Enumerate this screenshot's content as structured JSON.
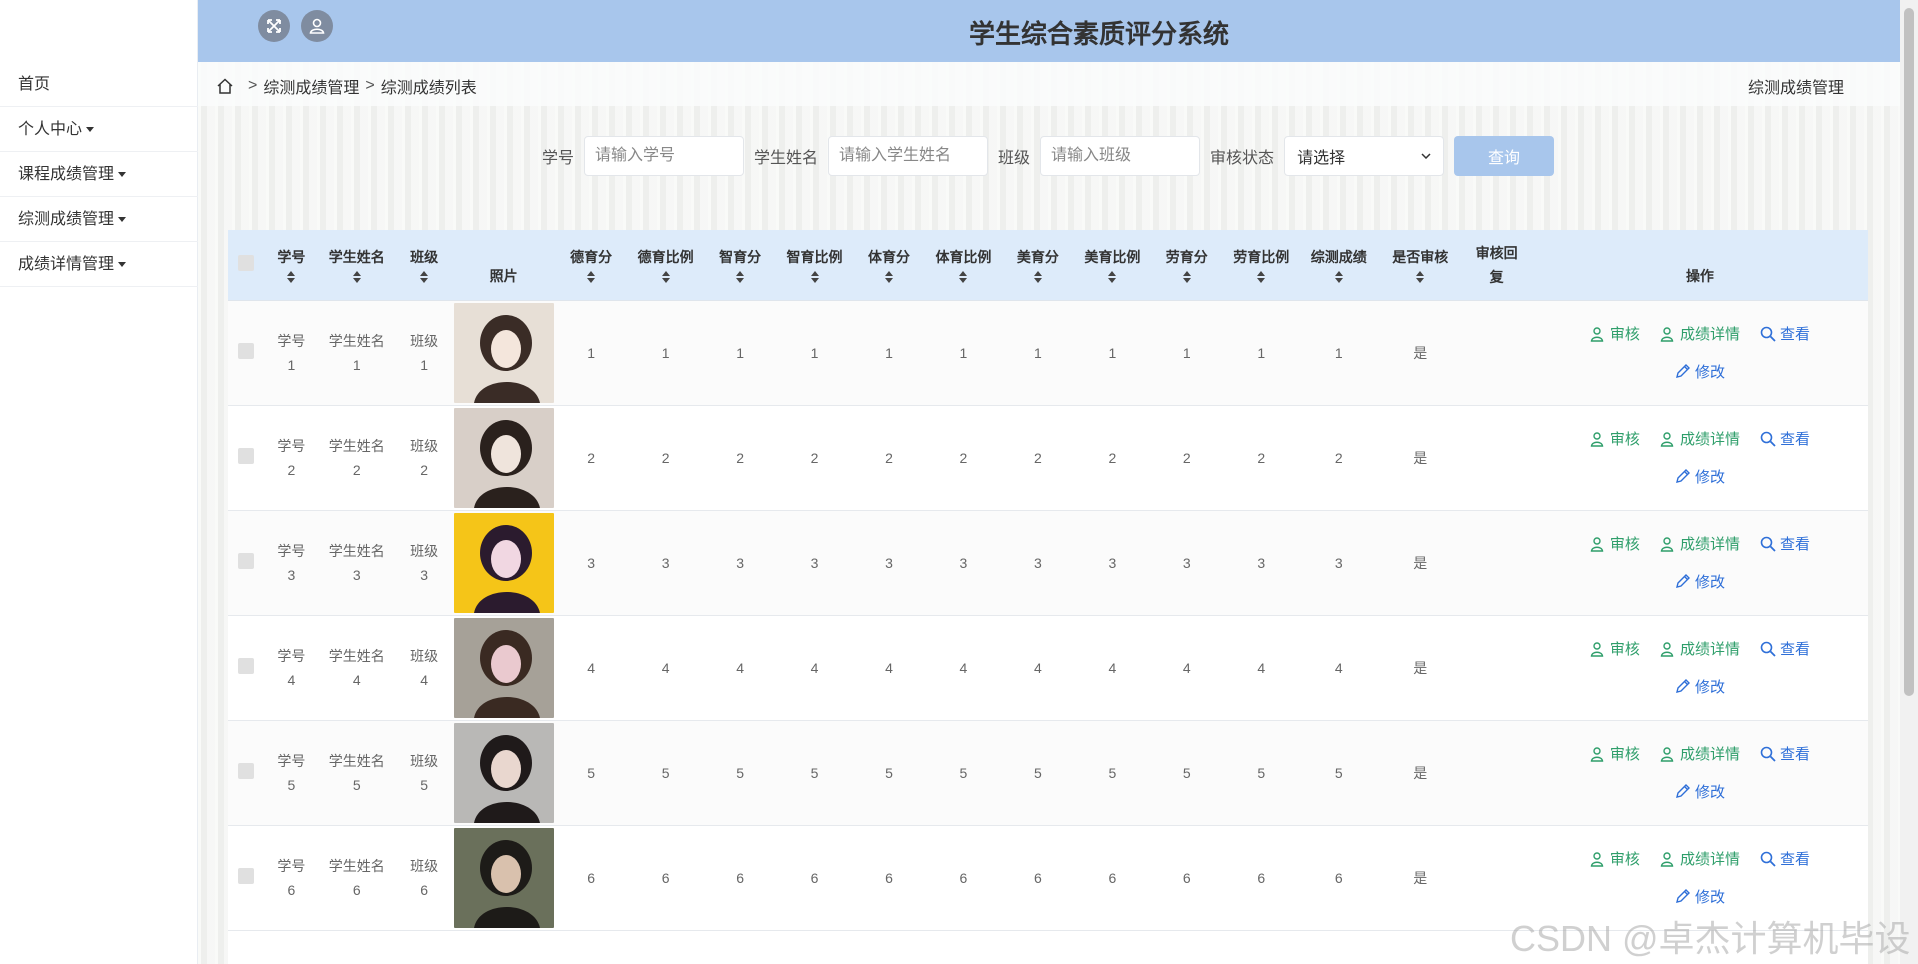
{
  "header": {
    "title": "学生综合素质评分系统",
    "fullscreen_icon": "expand-icon",
    "user_icon": "user-icon"
  },
  "sidebar": {
    "items": [
      {
        "label": "首页",
        "dropdown": false
      },
      {
        "label": "个人中心",
        "dropdown": true
      },
      {
        "label": "课程成绩管理",
        "dropdown": true
      },
      {
        "label": "综测成绩管理",
        "dropdown": true
      },
      {
        "label": "成绩详情管理",
        "dropdown": true
      }
    ]
  },
  "breadcrumb": {
    "items": [
      "综测成绩管理",
      "综测成绩列表"
    ],
    "separator": ">",
    "right_title": "综测成绩管理"
  },
  "search": {
    "student_no_label": "学号",
    "student_no_placeholder": "请输入学号",
    "name_label": "学生姓名",
    "name_placeholder": "请输入学生姓名",
    "class_label": "班级",
    "class_placeholder": "请输入班级",
    "status_label": "审核状态",
    "status_value": "请选择",
    "query_button": "查询"
  },
  "table": {
    "headers": {
      "student_no": "学号",
      "name": "学生姓名",
      "class": "班级",
      "photo": "照片",
      "de": "德育分",
      "de_ratio": "德育比例",
      "zhi": "智育分",
      "zhi_ratio": "智育比例",
      "ti": "体育分",
      "ti_ratio": "体育比例",
      "mei": "美育分",
      "mei_ratio": "美育比例",
      "lao": "劳育分",
      "lao_ratio": "劳育比例",
      "total": "综测成绩",
      "reviewed": "是否审核",
      "reply": "审核回复",
      "ops": "操作"
    },
    "op_labels": {
      "review": "审核",
      "detail": "成绩详情",
      "view": "查看",
      "edit": "修改"
    },
    "rows": [
      {
        "no_a": "学号",
        "no_b": "1",
        "name_a": "学生姓名",
        "name_b": "1",
        "class_a": "班级",
        "class_b": "1",
        "de": "1",
        "de_ratio": "1",
        "zhi": "1",
        "zhi_ratio": "1",
        "ti": "1",
        "ti_ratio": "1",
        "mei": "1",
        "mei_ratio": "1",
        "lao": "1",
        "lao_ratio": "1",
        "total": "1",
        "reviewed": "是",
        "reply": ""
      },
      {
        "no_a": "学号",
        "no_b": "2",
        "name_a": "学生姓名",
        "name_b": "2",
        "class_a": "班级",
        "class_b": "2",
        "de": "2",
        "de_ratio": "2",
        "zhi": "2",
        "zhi_ratio": "2",
        "ti": "2",
        "ti_ratio": "2",
        "mei": "2",
        "mei_ratio": "2",
        "lao": "2",
        "lao_ratio": "2",
        "total": "2",
        "reviewed": "是",
        "reply": ""
      },
      {
        "no_a": "学号",
        "no_b": "3",
        "name_a": "学生姓名",
        "name_b": "3",
        "class_a": "班级",
        "class_b": "3",
        "de": "3",
        "de_ratio": "3",
        "zhi": "3",
        "zhi_ratio": "3",
        "ti": "3",
        "ti_ratio": "3",
        "mei": "3",
        "mei_ratio": "3",
        "lao": "3",
        "lao_ratio": "3",
        "total": "3",
        "reviewed": "是",
        "reply": ""
      },
      {
        "no_a": "学号",
        "no_b": "4",
        "name_a": "学生姓名",
        "name_b": "4",
        "class_a": "班级",
        "class_b": "4",
        "de": "4",
        "de_ratio": "4",
        "zhi": "4",
        "zhi_ratio": "4",
        "ti": "4",
        "ti_ratio": "4",
        "mei": "4",
        "mei_ratio": "4",
        "lao": "4",
        "lao_ratio": "4",
        "total": "4",
        "reviewed": "是",
        "reply": ""
      },
      {
        "no_a": "学号",
        "no_b": "5",
        "name_a": "学生姓名",
        "name_b": "5",
        "class_a": "班级",
        "class_b": "5",
        "de": "5",
        "de_ratio": "5",
        "zhi": "5",
        "zhi_ratio": "5",
        "ti": "5",
        "ti_ratio": "5",
        "mei": "5",
        "mei_ratio": "5",
        "lao": "5",
        "lao_ratio": "5",
        "total": "5",
        "reviewed": "是",
        "reply": ""
      },
      {
        "no_a": "学号",
        "no_b": "6",
        "name_a": "学生姓名",
        "name_b": "6",
        "class_a": "班级",
        "class_b": "6",
        "de": "6",
        "de_ratio": "6",
        "zhi": "6",
        "zhi_ratio": "6",
        "ti": "6",
        "ti_ratio": "6",
        "mei": "6",
        "mei_ratio": "6",
        "lao": "6",
        "lao_ratio": "6",
        "total": "6",
        "reviewed": "是",
        "reply": ""
      }
    ]
  },
  "watermark": "CSDN @卓杰计算机毕设",
  "colors": {
    "header_bg": "#a8c6ec",
    "table_header_bg": "#ddebfa",
    "op_green": "#2e9e6a",
    "op_blue": "#2e6fd8"
  }
}
